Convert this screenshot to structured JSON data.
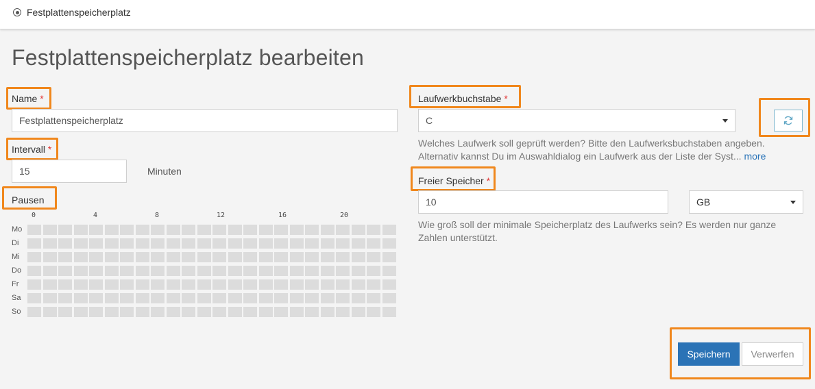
{
  "breadcrumb": {
    "icon": "radio-icon",
    "label": "Festplattenspeicherplatz"
  },
  "page_title": "Festplattenspeicherplatz bearbeiten",
  "highlight_color": "#f0871c",
  "required_marker": "*",
  "name_field": {
    "label": "Name",
    "value": "Festplattenspeicherplatz"
  },
  "interval_field": {
    "label": "Intervall",
    "value": "15",
    "unit": "Minuten"
  },
  "pauses": {
    "label": "Pausen",
    "hours": [
      "0",
      "4",
      "8",
      "12",
      "16",
      "20"
    ],
    "days": [
      "Mo",
      "Di",
      "Mi",
      "Do",
      "Fr",
      "Sa",
      "So"
    ],
    "cells_per_day": 24
  },
  "drive_field": {
    "label": "Laufwerkbuchstabe",
    "value": "C",
    "help": "Welches Laufwerk soll geprüft werden? Bitte den Laufwerksbuchstaben angeben. Alternativ kannst Du im Auswahldialog ein Laufwerk aus der Liste der Syst...",
    "more": "more",
    "refresh_icon": "refresh-icon"
  },
  "free_space_field": {
    "label": "Freier Speicher",
    "value": "10",
    "unit_value": "GB",
    "help": "Wie groß soll der minimale Speicherplatz des Laufwerks sein? Es werden nur ganze Zahlen unterstützt."
  },
  "actions": {
    "save": "Speichern",
    "discard": "Verwerfen"
  }
}
